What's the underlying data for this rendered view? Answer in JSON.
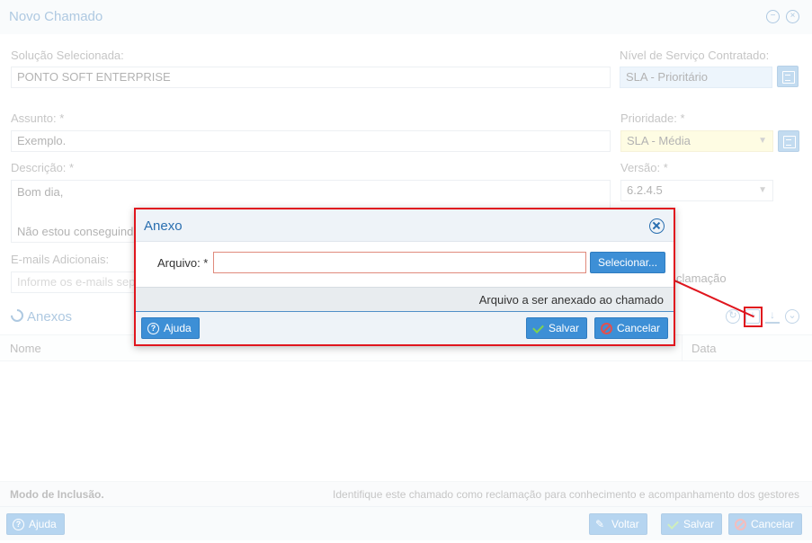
{
  "window": {
    "title": "Novo Chamado",
    "solution_label": "Solução Selecionada:",
    "solution_value": "PONTO SOFT ENTERPRISE",
    "sla_label": "Nível de Serviço Contratado:",
    "sla_value": "SLA - Prioritário",
    "subject_label": "Assunto: *",
    "subject_value": "Exemplo.",
    "priority_label": "Prioridade: *",
    "priority_value": "SLA - Média",
    "description_label": "Descrição: *",
    "description_value": "Bom dia,\n\nNão estou conseguind\nPodem nos auxiliar?",
    "version_label": "Versão: *",
    "version_value": "6.2.4.5",
    "emails_label": "E-mails Adicionais:",
    "emails_placeholder": "Informe os e-mails sep",
    "complaint_partial": "clamação",
    "attachments_title": "Anexos",
    "grid": {
      "col_name": "Nome",
      "col_date": "Data"
    },
    "mode_label": "Modo de Inclusão.",
    "mode_hint": "Identifique este chamado como reclamação para conhecimento e acompanhamento dos gestores",
    "footer": {
      "help": "Ajuda",
      "back": "Voltar",
      "save": "Salvar",
      "cancel": "Cancelar"
    }
  },
  "dialog": {
    "title": "Anexo",
    "file_label": "Arquivo: *",
    "file_value": "",
    "select_button": "Selecionar...",
    "hint": "Arquivo a ser anexado ao chamado",
    "help_button": "Ajuda",
    "save_button": "Salvar",
    "cancel_button": "Cancelar"
  },
  "colors": {
    "accent": "#3d8fd6",
    "highlight": "#e0161e",
    "sla_field": "#cfe3f7",
    "priority_field": "#fcf6b6"
  },
  "icons": [
    "minimize-icon",
    "close-icon",
    "list-picker-icon",
    "paperclip-icon",
    "refresh-icon",
    "add-icon",
    "download-icon",
    "expand-icon",
    "help-icon",
    "check-icon",
    "cancel-icon",
    "edit-icon"
  ]
}
